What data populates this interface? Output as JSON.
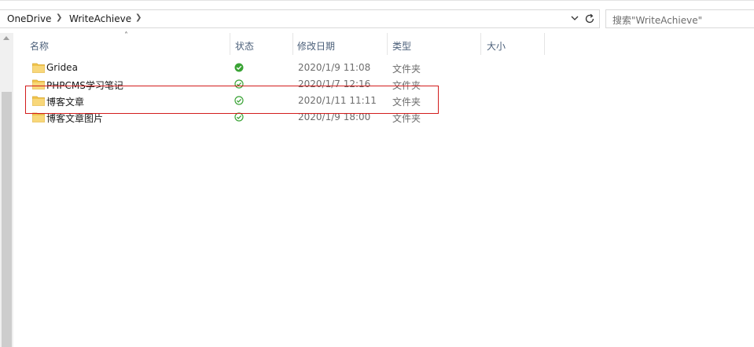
{
  "address": {
    "breadcrumbs": [
      "OneDrive",
      "WriteAchieve"
    ]
  },
  "search": {
    "placeholder": "搜索\"WriteAchieve\""
  },
  "columns": [
    {
      "label": "名称"
    },
    {
      "label": "状态"
    },
    {
      "label": "修改日期"
    },
    {
      "label": "类型"
    },
    {
      "label": "大小"
    }
  ],
  "files": [
    {
      "name": "Gridea",
      "status": "synced",
      "modified": "2020/1/9 11:08",
      "type": "文件夹"
    },
    {
      "name": "PHPCMS学习笔记",
      "status": "synced",
      "modified": "2020/1/7 12:16",
      "type": "文件夹"
    },
    {
      "name": "博客文章",
      "status": "available",
      "modified": "2020/1/11 11:11",
      "type": "文件夹"
    },
    {
      "name": "博客文章图片",
      "status": "synced",
      "modified": "2020/1/9 18:00",
      "type": "文件夹"
    }
  ],
  "colors": {
    "accent_highlight": "#d21c1c",
    "status_green": "#3aa335",
    "folder": "#f0c44c"
  },
  "icons": {
    "status_synced": "green-check-filled-icon",
    "status_available": "green-check-outline-icon",
    "folder": "folder-icon",
    "refresh": "refresh-icon",
    "dropdown": "chevron-down-icon"
  }
}
